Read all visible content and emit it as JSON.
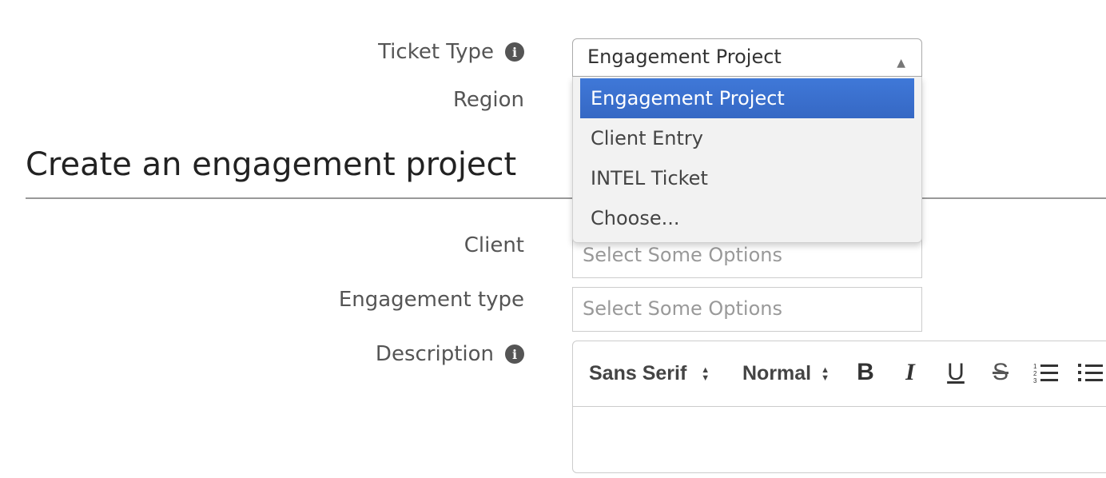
{
  "form": {
    "ticket_type_label": "Ticket Type",
    "region_label": "Region",
    "ticket_type_value": "Engagement Project",
    "dropdown_options": [
      "Engagement Project",
      "Client Entry",
      "INTEL Ticket",
      "Choose..."
    ],
    "selected_option_index": 0
  },
  "section": {
    "title": "Create an engagement project"
  },
  "fields": {
    "client_label": "Client",
    "client_placeholder": "Select Some Options",
    "engagement_type_label": "Engagement type",
    "engagement_type_placeholder": "Select Some Options",
    "description_label": "Description"
  },
  "editor": {
    "font_value": "Sans Serif",
    "size_value": "Normal",
    "bold_label": "B",
    "italic_label": "I",
    "underline_label": "U",
    "strike_label": "S"
  },
  "colors": {
    "selected_option_bg": "#3668c4",
    "dropdown_bg": "#f2f2f2"
  }
}
